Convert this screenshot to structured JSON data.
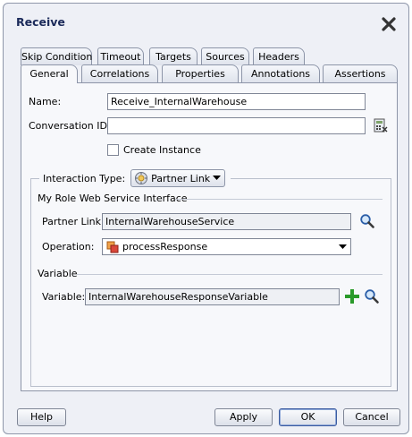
{
  "dialog": {
    "title": "Receive"
  },
  "tabs_row1": [
    "Skip Condition",
    "Timeout",
    "Targets",
    "Sources",
    "Headers"
  ],
  "tabs_row2": [
    "General",
    "Correlations",
    "Properties",
    "Annotations",
    "Assertions"
  ],
  "active_tab": "General",
  "general": {
    "name_label": "Name:",
    "name_value": "Receive_InternalWarehouse",
    "conversation_label": "Conversation ID:",
    "conversation_value": "",
    "create_instance_label": "Create Instance",
    "create_instance_checked": false,
    "interaction_type_label": "Interaction Type:",
    "interaction_type_value": "Partner Link",
    "my_role_header": "My Role Web Service Interface",
    "partner_link_label": "Partner Link:",
    "partner_link_value": "InternalWarehouseService",
    "operation_label": "Operation:",
    "operation_value": "processResponse",
    "variable_header": "Variable",
    "variable_label": "Variable:",
    "variable_value": "InternalWarehouseResponseVariable"
  },
  "buttons": {
    "help": "Help",
    "apply": "Apply",
    "ok": "OK",
    "cancel": "Cancel"
  },
  "colors": {
    "dialog_bg": "#eef0f6",
    "panel_bg": "#f7f8fb",
    "title": "#1b2a5a",
    "add_green": "#2a9a2a"
  }
}
